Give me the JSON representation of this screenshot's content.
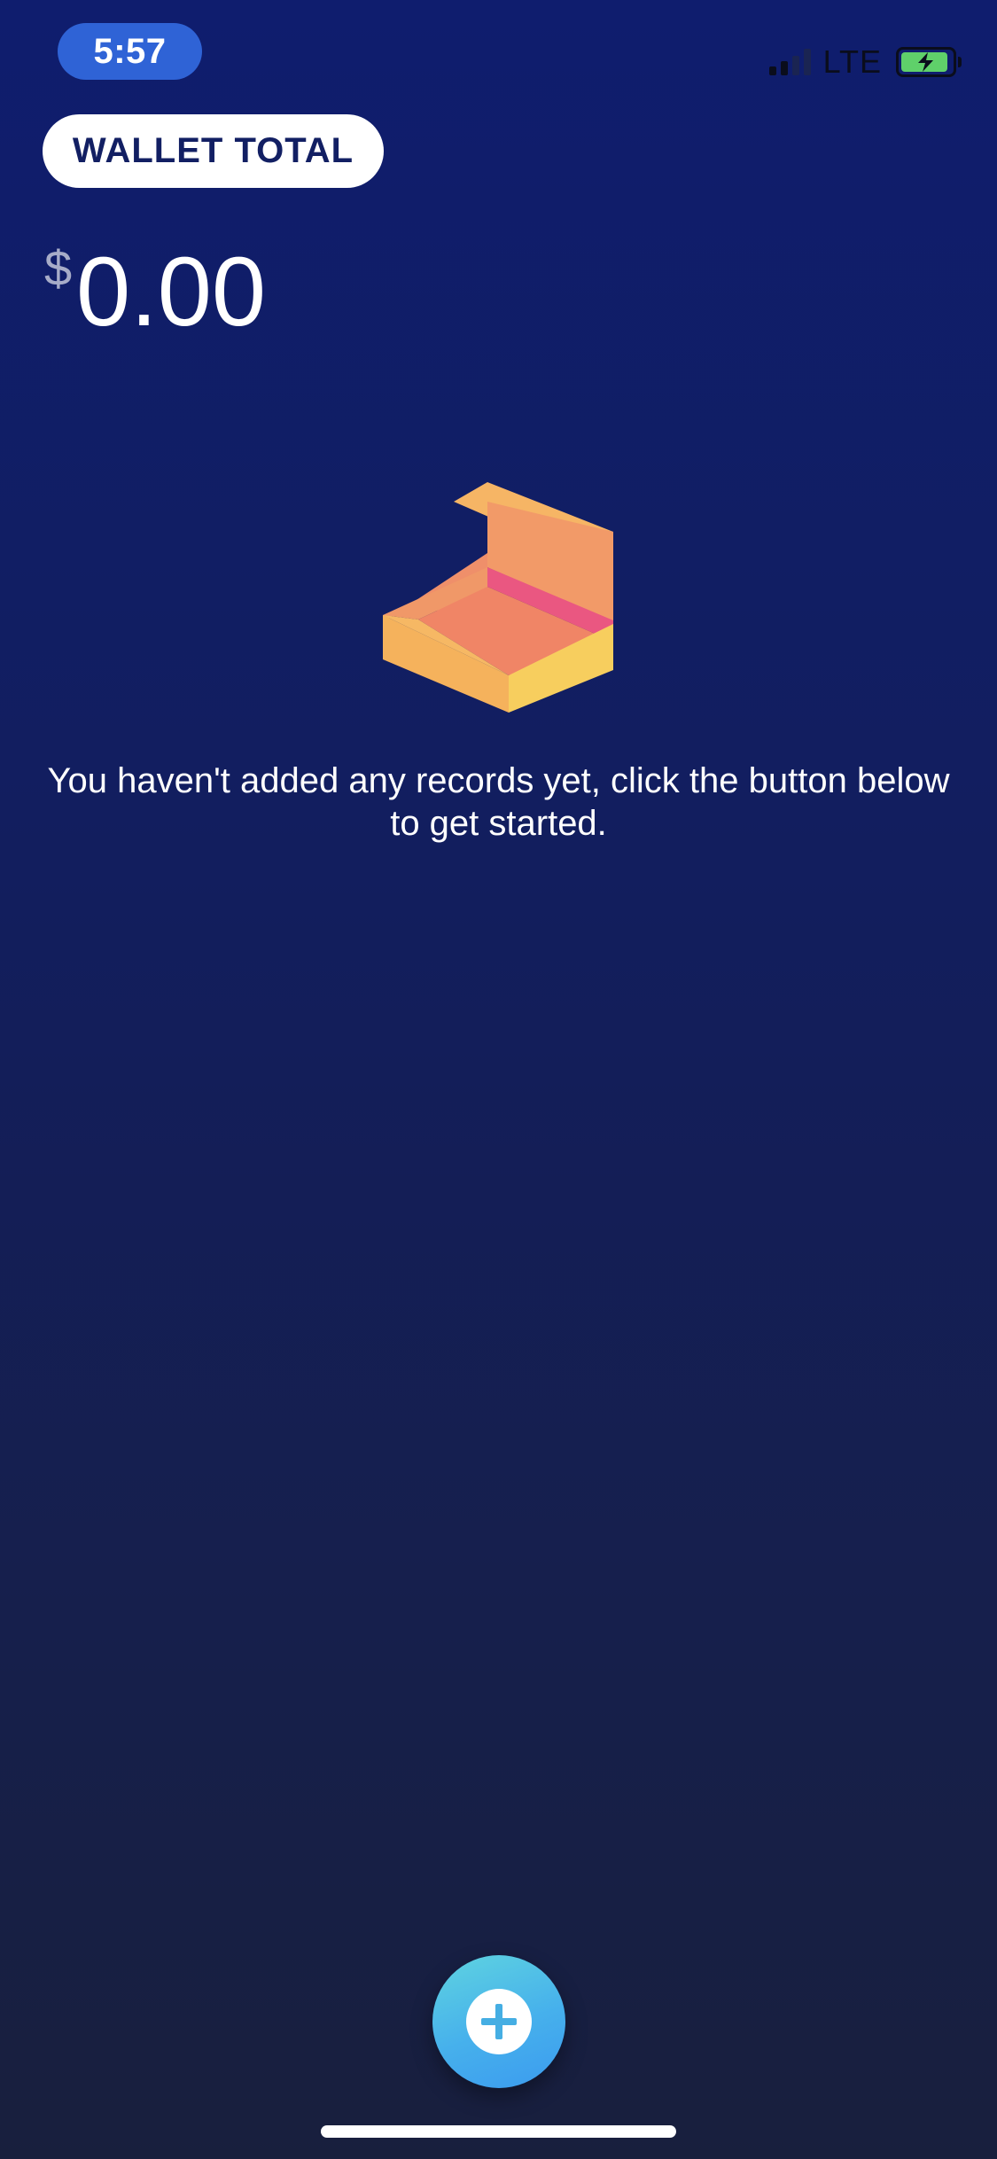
{
  "status_bar": {
    "time": "5:57",
    "network": "LTE",
    "icons": [
      "cellular-signal-icon",
      "battery-charging-icon"
    ]
  },
  "wallet": {
    "label": "WALLET TOTAL",
    "currency_symbol": "$",
    "amount": "0.00"
  },
  "empty_state": {
    "icon": "open-box-icon",
    "message": "You haven't added any records yet, click the button below to get started."
  },
  "fab": {
    "icon": "plus-icon"
  },
  "colors": {
    "background_top": "#0f1d6e",
    "background_bottom": "#181f3d",
    "time_pill": "#2f63d6",
    "wallet_label_text": "#121f63",
    "fab_gradient_start": "#5fd4e0",
    "fab_gradient_end": "#3b9bef",
    "box_orange": "#f3a06a",
    "box_pink": "#ea5781",
    "box_yellow": "#f6cb5d"
  }
}
